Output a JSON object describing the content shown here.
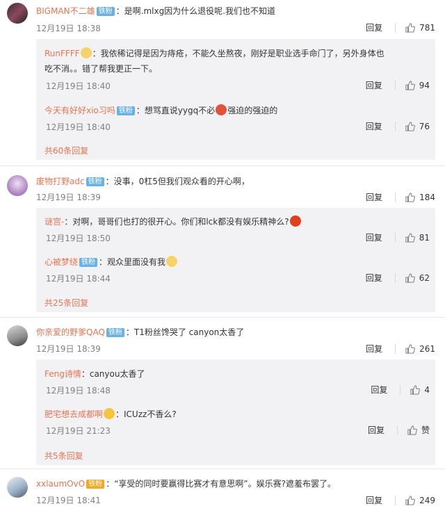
{
  "comments": [
    {
      "user": "BIGMAN不二雄",
      "badge": "铁粉",
      "text": "：是啊.mlxg因为什么退役呢.我们也不知道",
      "time": "12月19日 18:38",
      "reply_label": "回复",
      "likes": "781",
      "replies": [
        {
          "user": "RunFFFF",
          "text_line1": "：我依稀记得是因为痔疮，不能久坐熬夜，刚好是职业选手命门了，另外身体也",
          "text_line2": "吃不消。。错了帮我更正一下。",
          "time": "12月19日 18:40",
          "reply_label": "回复",
          "likes": "94"
        },
        {
          "user": "今天有好好xio习吗",
          "badge": "铁粉",
          "text_a": "：想骂直说yygq不必",
          "text_b": "强迫的强迫的",
          "time": "12月19日 18:40",
          "reply_label": "回复",
          "likes": "76"
        }
      ],
      "more": "共60条回复"
    },
    {
      "user": "废物打野adc",
      "badge": "铁粉",
      "text": "：没事，0杠5但我们观众看的开心啊，",
      "time": "12月19日 18:39",
      "reply_label": "回复",
      "likes": "184",
      "replies": [
        {
          "user": "谜宫-",
          "text": "：对啊，哥哥们也打的很开心。你们和lck都没有娱乐精神么?",
          "time": "12月19日 18:50",
          "reply_label": "回复",
          "likes": "81"
        },
        {
          "user": "心被梦绕",
          "badge": "铁粉",
          "text": "：观众里面没有我",
          "time": "12月19日 18:44",
          "reply_label": "回复",
          "likes": "62"
        }
      ],
      "more": "共25条回复"
    },
    {
      "user": "你亲爱的野爹QAQ",
      "badge": "铁粉",
      "text": "：T1粉丝馋哭了 canyon太香了",
      "time": "12月19日 18:39",
      "reply_label": "回复",
      "likes": "261",
      "replies": [
        {
          "user": "Feng诗情",
          "text": "：canyou太香了",
          "time": "12月19日 18:48",
          "reply_label": "回复",
          "likes": "4"
        },
        {
          "user": "肥宅想去成都啊",
          "text": "：ICUzz不香么?",
          "time": "12月19日 21:23",
          "reply_label": "回复",
          "likes": "赞"
        }
      ],
      "more": "共5条回复"
    },
    {
      "user": "xxlaumOvO",
      "badge": "铁粉",
      "text": "：“享受的同时要赢得比赛才有意思啊”。娱乐赛?遮羞布罢了。",
      "time": "12月19日 18:41",
      "reply_label": "回复",
      "likes": "249"
    }
  ]
}
